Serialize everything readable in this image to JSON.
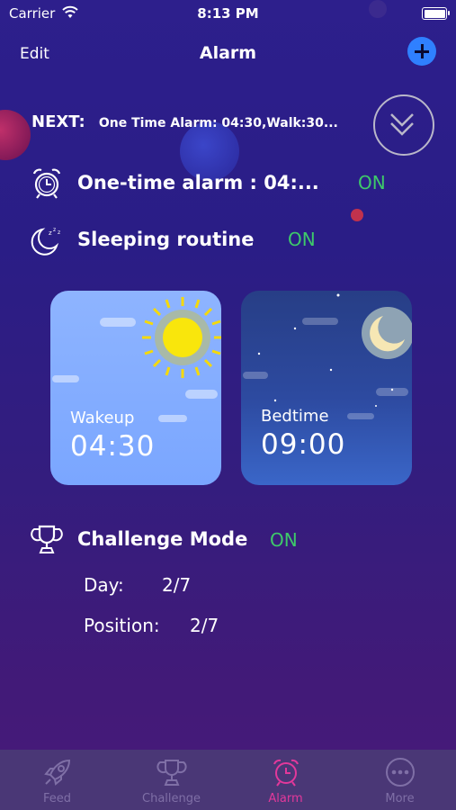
{
  "status_bar": {
    "carrier": "Carrier",
    "time": "8:13 PM"
  },
  "nav": {
    "edit_label": "Edit",
    "title": "Alarm"
  },
  "next": {
    "label": "NEXT:",
    "text": "One Time Alarm: 04:30,Walk:30..."
  },
  "one_time_alarm": {
    "label": "One-time alarm : 04:...",
    "status": "ON"
  },
  "sleeping_routine": {
    "label": "Sleeping routine",
    "status": "ON"
  },
  "wakeup_card": {
    "title": "Wakeup",
    "time": "04:30"
  },
  "bedtime_card": {
    "title": "Bedtime",
    "time": "09:00"
  },
  "challenge_mode": {
    "label": "Challenge Mode",
    "status": "ON",
    "day_label": "Day:",
    "day_value": "2/7",
    "position_label": "Position:",
    "position_value": "2/7"
  },
  "tabs": [
    {
      "label": "Feed",
      "icon": "rocket-icon"
    },
    {
      "label": "Challenge",
      "icon": "trophy-icon"
    },
    {
      "label": "Alarm",
      "icon": "alarm-clock-icon"
    },
    {
      "label": "More",
      "icon": "more-icon"
    }
  ],
  "colors": {
    "accent_on": "#3ec96a",
    "active_tab": "#e3389b",
    "add_button": "#2f80ff"
  }
}
